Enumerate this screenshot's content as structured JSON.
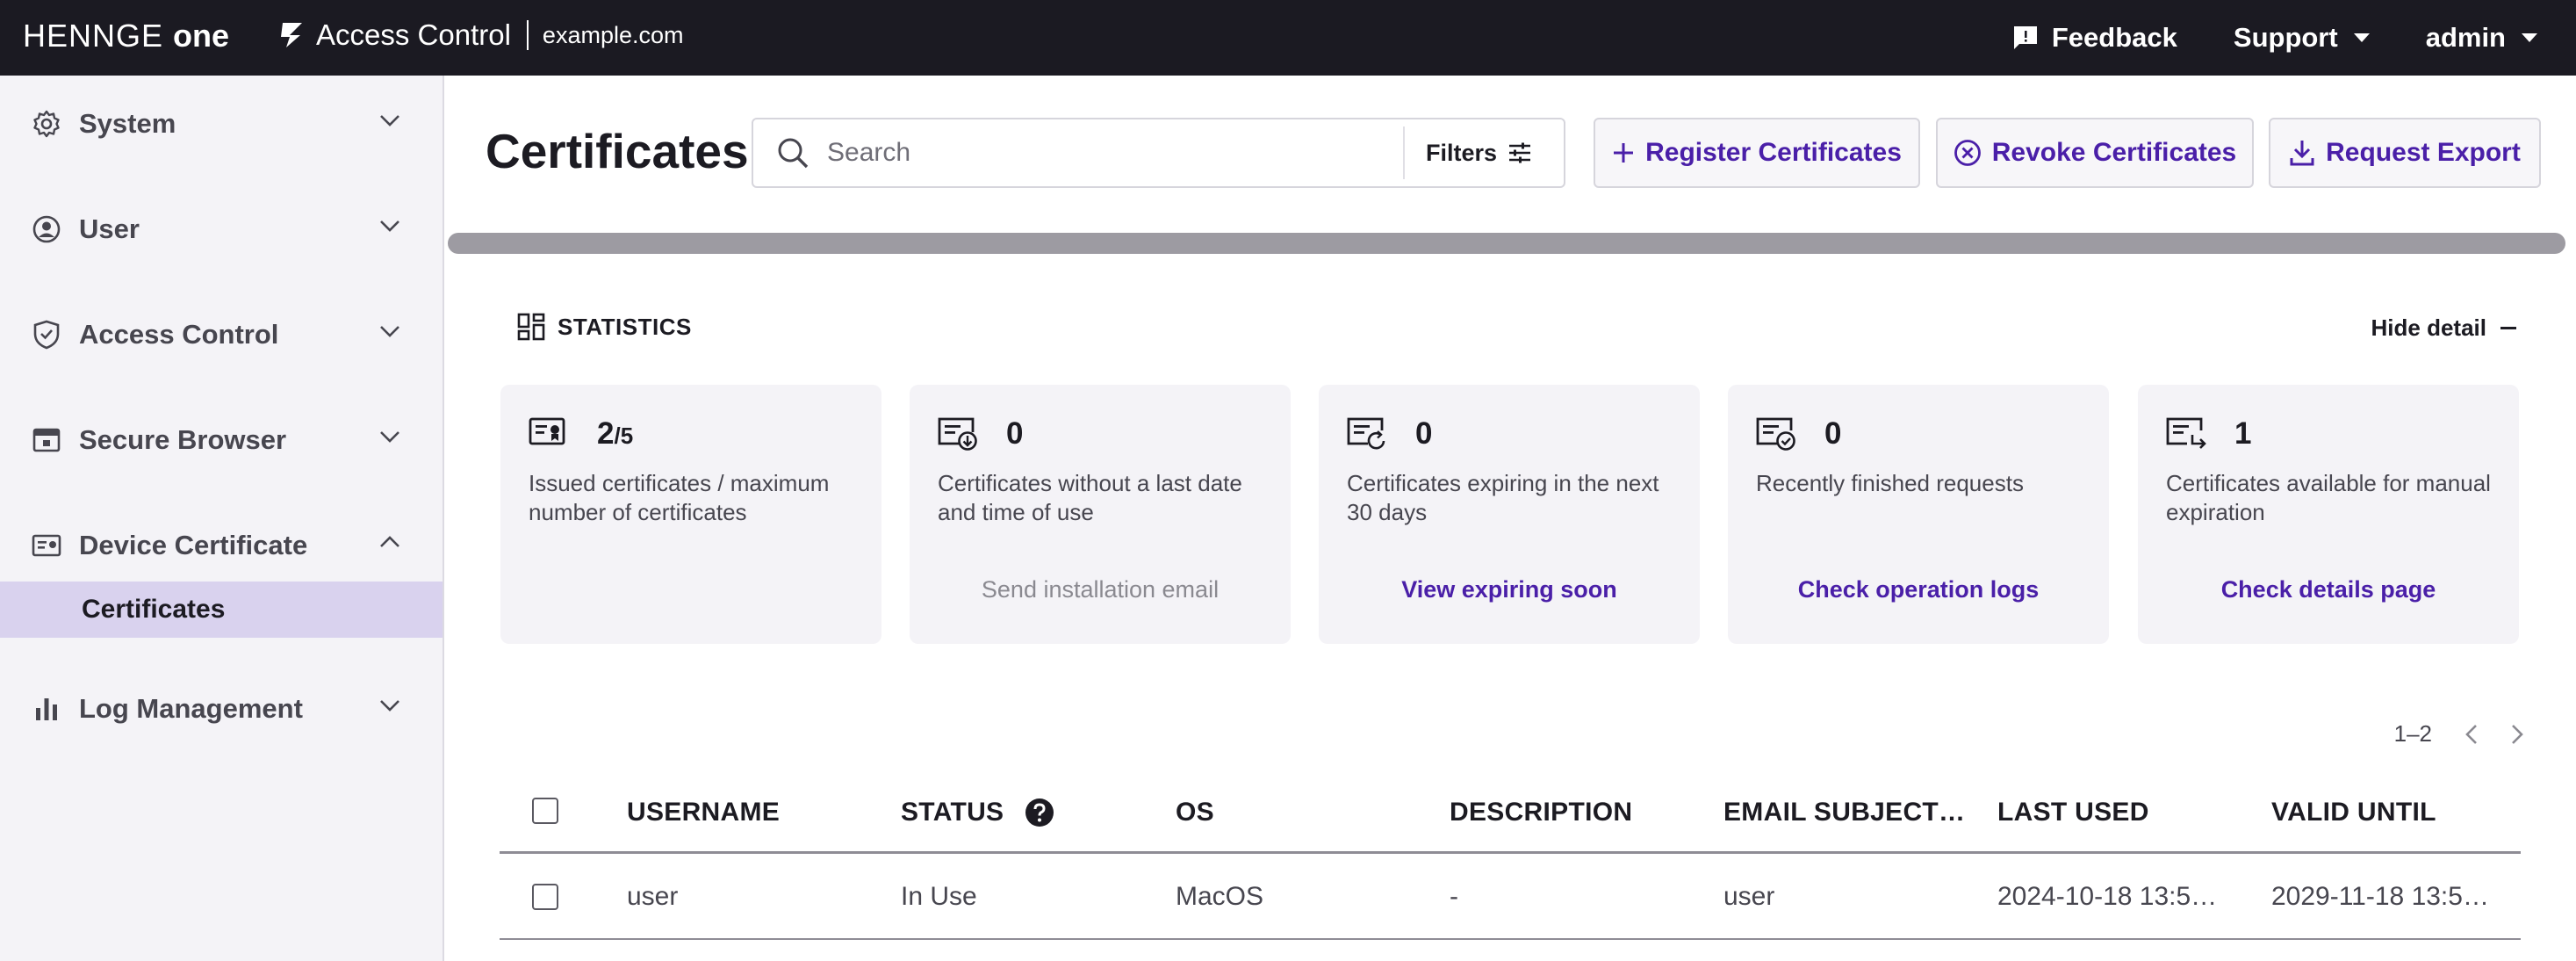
{
  "topbar": {
    "brand_prefix": "HENNGE",
    "brand_suffix": "one",
    "product": "Access Control",
    "tenant": "example.com",
    "nav": {
      "feedback": "Feedback",
      "support": "Support",
      "admin": "admin"
    }
  },
  "sidebar": {
    "items": [
      {
        "label": "System",
        "icon": "gear-icon"
      },
      {
        "label": "User",
        "icon": "user-circle-icon"
      },
      {
        "label": "Access Control",
        "icon": "shield-icon"
      },
      {
        "label": "Secure Browser",
        "icon": "browser-window-icon"
      },
      {
        "label": "Device Certificate",
        "icon": "certificate-card-icon",
        "expanded": true
      },
      {
        "label": "Log Management",
        "icon": "bar-chart-icon"
      }
    ],
    "sub_item": "Certificates"
  },
  "main": {
    "title": "Certificates",
    "search_placeholder": "Search",
    "filters_label": "Filters",
    "actions": {
      "register": "Register Certificates",
      "revoke": "Revoke Certificates",
      "export": "Request Export"
    }
  },
  "statistics": {
    "heading": "STATISTICS",
    "hide_detail": "Hide detail",
    "cards": [
      {
        "value": "2",
        "max": "/5",
        "description": "Issued certificates / maximum number of certificates",
        "link": ""
      },
      {
        "value": "0",
        "description": "Certificates without a last date and time of use",
        "link": "Send installation email"
      },
      {
        "value": "0",
        "description": "Certificates expiring in the next 30 days",
        "link": "View expiring soon"
      },
      {
        "value": "0",
        "description": "Recently finished requests",
        "link": "Check operation logs"
      },
      {
        "value": "1",
        "description": "Certificates available for manual expiration",
        "link": "Check details page"
      }
    ]
  },
  "table": {
    "pagination": "1–2",
    "columns": [
      "USERNAME",
      "STATUS",
      "OS",
      "DESCRIPTION",
      "EMAIL SUBJECT…",
      "LAST USED",
      "VALID UNTIL"
    ],
    "rows": [
      {
        "username": "user",
        "status": "In Use",
        "os": "MacOS",
        "description": "-",
        "email_subject": "user",
        "last_used": "2024-10-18 13:5…",
        "valid_until": "2029-11-18 13:5…"
      }
    ]
  },
  "colors": {
    "topbar_bg": "#1b1a22",
    "accent": "#4a1fa8",
    "sidebar_bg": "#f4f3f7",
    "sidebar_selected": "#d9d2ee"
  }
}
